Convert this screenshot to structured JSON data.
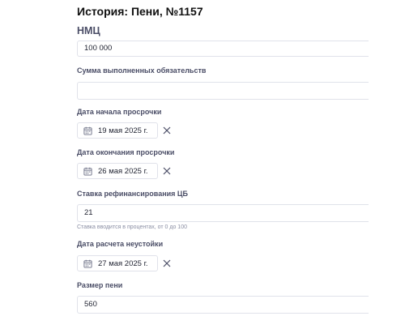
{
  "header": {
    "title": "История: Пени, №1157"
  },
  "form": {
    "nmc": {
      "label": "НМЦ",
      "value": "100 000"
    },
    "obligations_sum": {
      "label": "Сумма выполненных обязательств",
      "value": ""
    },
    "overdue_start": {
      "label": "Дата начала просрочки",
      "value": "19 мая 2025 г.",
      "icon": "calendar-icon",
      "clear_icon": "close-icon"
    },
    "overdue_end": {
      "label": "Дата окончания просрочки",
      "value": "26 мая 2025 г.",
      "icon": "calendar-icon",
      "clear_icon": "close-icon"
    },
    "refinancing_rate": {
      "label": "Ставка рефинансирования ЦБ",
      "value": "21",
      "hint": "Ставка вводится в процентах, от 0 до 100"
    },
    "penalty_calc_date": {
      "label": "Дата расчета неустойки",
      "value": "27 мая 2025 г.",
      "icon": "calendar-icon",
      "clear_icon": "close-icon"
    },
    "penalty_amount": {
      "label": "Размер пени",
      "value": "560"
    }
  },
  "colors": {
    "label": "#4a4d66",
    "border": "#e0e2ea",
    "hint": "#8a8ea3",
    "text": "#1f2230"
  }
}
